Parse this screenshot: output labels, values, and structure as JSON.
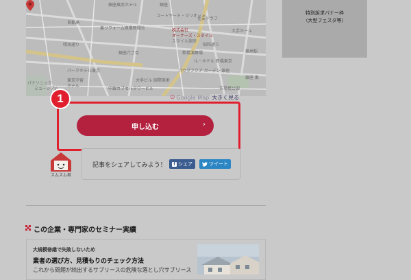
{
  "map": {
    "labels": [
      "コートヤード・マリオット",
      "銀座東武ホテル",
      "銀座",
      "住友ドラフ",
      "楽リフォーム産業新聞社",
      "晴海通り",
      "昭和通り",
      "首都高",
      "大手ホール",
      "築地駅",
      "銀座六丁目",
      "新橋演舞場",
      "パナソニック",
      "ミュージアム",
      "東京汐留",
      "ホテル",
      "パークホテル東京",
      "中銀カプセルタワービル",
      "パウダアクア ガーデン 銀座",
      "市場橋公園",
      "大手ビル 国際美術",
      "ル・ホテル 新橋東京",
      "銀座 東"
    ],
    "business_name_line1": "株式会社",
    "business_name_line2": "オーナーズ・スタイル",
    "business_sub": "スタイル銀座",
    "attribution": "Google Map",
    "enlarge_link": "大きく見る"
  },
  "banner": {
    "line1": "特別訴求バナー枠",
    "line2": "（大型フェスタ等）"
  },
  "step_badge": "1",
  "apply_button": {
    "label": "申し込む",
    "chevron": "›"
  },
  "mascot_label": "スムスム君",
  "share": {
    "prompt": "記事をシェアしてみよう！",
    "facebook": "シェア",
    "twitter": "ツイート"
  },
  "section": {
    "title": "この企業・専門家のセミナー実績"
  },
  "seminar_card": {
    "kicker": "大規模修繕で失敗しないため",
    "title": "業者の選び方、見積もりのチェック方法",
    "desc": "これから問題が続出するサブリースの危険な落とし穴サブリース"
  },
  "colors": {
    "highlight": "#e01e2e",
    "button": "#b3213f",
    "facebook": "#3a5c8f",
    "twitter": "#2d86c4",
    "background": "#c9c9c9"
  }
}
